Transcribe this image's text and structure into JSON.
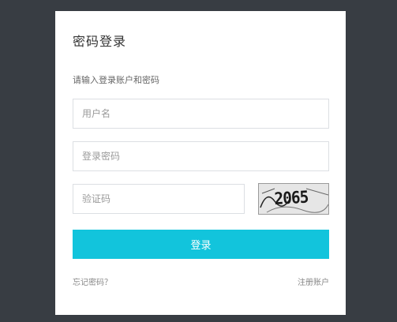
{
  "login": {
    "title": "密码登录",
    "subtitle": "请输入登录账户和密码",
    "username_placeholder": "用户名",
    "password_placeholder": "登录密码",
    "captcha_placeholder": "验证码",
    "captcha_text": "2065",
    "login_button": "登录",
    "forgot_link": "忘记密码？",
    "register_link": "注册账户"
  },
  "colors": {
    "background": "#383d43",
    "card": "#ffffff",
    "button": "#12c4dc"
  }
}
